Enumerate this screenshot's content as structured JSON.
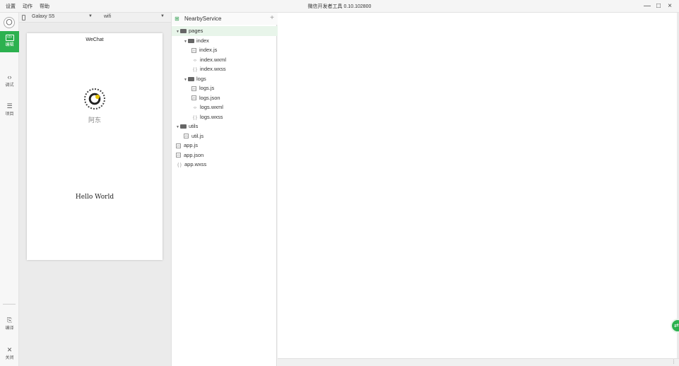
{
  "menu": [
    "设置",
    "动作",
    "帮助"
  ],
  "window": {
    "title": "微信开发者工具 0.10.102800",
    "controls": {
      "minimize": "—",
      "maximize": "□",
      "close": "×"
    }
  },
  "sidebar": {
    "items": [
      {
        "label": "编辑",
        "icon": "code-icon",
        "glyph": "</>"
      },
      {
        "label": "调试",
        "icon": "debug-icon",
        "glyph": "‹›"
      },
      {
        "label": "项目",
        "icon": "project-icon",
        "glyph": "☰"
      },
      {
        "label": "编译",
        "icon": "compile-icon",
        "glyph": "⎘"
      },
      {
        "label": "关闭",
        "icon": "close-icon",
        "glyph": "✕"
      }
    ]
  },
  "simulator": {
    "device": "Galaxy S5",
    "network": "wifi",
    "page_title": "WeChat",
    "nickname": "阿东",
    "hello": "Hello World"
  },
  "explorer": {
    "project_name": "NearbyService",
    "add_glyph": "+",
    "tree": [
      {
        "name": "pages",
        "type": "folder",
        "depth": 0,
        "open": true,
        "selected": true
      },
      {
        "name": "index",
        "type": "folder",
        "depth": 1,
        "open": true
      },
      {
        "name": "index.js",
        "type": "js",
        "depth": 2
      },
      {
        "name": "index.wxml",
        "type": "wxml",
        "depth": 2
      },
      {
        "name": "index.wxss",
        "type": "wxss",
        "depth": 2
      },
      {
        "name": "logs",
        "type": "folder",
        "depth": 1,
        "open": true
      },
      {
        "name": "logs.js",
        "type": "js",
        "depth": 2
      },
      {
        "name": "logs.json",
        "type": "json",
        "depth": 2
      },
      {
        "name": "logs.wxml",
        "type": "wxml",
        "depth": 2
      },
      {
        "name": "logs.wxss",
        "type": "wxss",
        "depth": 2
      },
      {
        "name": "utils",
        "type": "folder",
        "depth": 0,
        "open": true
      },
      {
        "name": "util.js",
        "type": "js",
        "depth": 1
      },
      {
        "name": "app.js",
        "type": "js",
        "depth": 0
      },
      {
        "name": "app.json",
        "type": "json",
        "depth": 0
      },
      {
        "name": "app.wxss",
        "type": "wxss",
        "depth": 0
      }
    ]
  },
  "colors": {
    "accent": "#2cb14f"
  }
}
